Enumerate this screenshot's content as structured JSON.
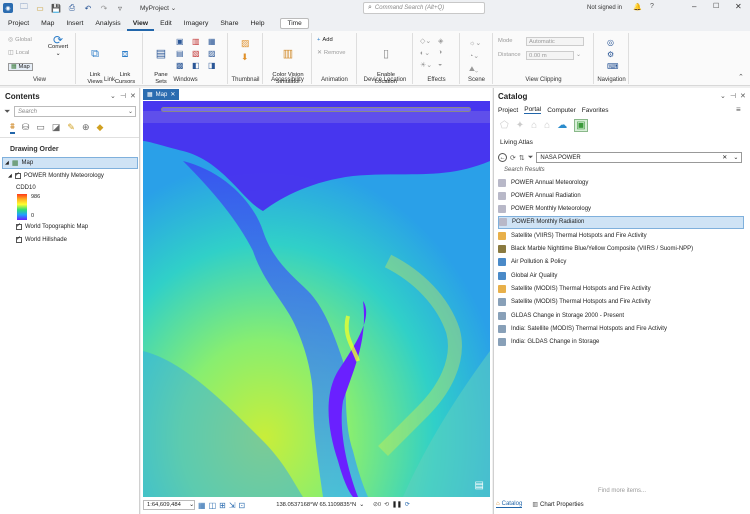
{
  "titlebar": {
    "project_name": "MyProject",
    "search_placeholder": "Command Search (Alt+Q)",
    "user_status": "Not signed in",
    "time_button": "Time"
  },
  "ribbon_tabs": [
    "Project",
    "Map",
    "Insert",
    "Analysis",
    "View",
    "Edit",
    "Imagery",
    "Share",
    "Help"
  ],
  "active_tab": "View",
  "ribbon": {
    "view": {
      "global": "Global",
      "local": "Local",
      "map": "Map",
      "convert": "Convert",
      "label": "View"
    },
    "link": {
      "link_views": "Link\nViews",
      "link_cursors": "Link\nCursors",
      "label": "Link"
    },
    "windows": {
      "pane_sets": "Pane\nSets",
      "label": "Windows"
    },
    "thumbnail": {
      "label": "Thumbnail"
    },
    "accessibility": {
      "color_vision": "Color Vision\nSimulator",
      "label": "Accessibility"
    },
    "animation": {
      "add": "Add",
      "remove": "Remove",
      "label": "Animation"
    },
    "device_location": {
      "enable": "Enable\nLocation",
      "label": "Device Location"
    },
    "effects": {
      "label": "Effects"
    },
    "scene": {
      "label": "Scene"
    },
    "view_clipping": {
      "mode_label": "Mode",
      "mode_value": "Automatic",
      "distance_label": "Distance",
      "distance_value": "0.00 m",
      "label": "View Clipping"
    },
    "navigation": {
      "label": "Navigation"
    }
  },
  "contents": {
    "title": "Contents",
    "search_placeholder": "Search",
    "drawing_order": "Drawing Order",
    "map_name": "Map",
    "layer_name": "POWER Monthly Meteorology",
    "legend_field": "CDD10",
    "legend_max": "986",
    "legend_min": "0",
    "basemap1": "World Topographic Map",
    "basemap2": "World Hillshade"
  },
  "map": {
    "tab_label": "Map",
    "scale": "1:64,609,484",
    "coordinates": "138.0537168°W 65.1109835°N",
    "selected_count": "0"
  },
  "catalog": {
    "title": "Catalog",
    "tabs": [
      "Project",
      "Portal",
      "Computer",
      "Favorites"
    ],
    "active_tab": "Portal",
    "section": "Living Atlas",
    "search_value": "NASA POWER",
    "results_label": "Search Results",
    "items": [
      {
        "label": "POWER Annual Meteorology",
        "icon": "raster-icon",
        "color": "#b8b8c8"
      },
      {
        "label": "POWER Annual Radiation",
        "icon": "raster-icon",
        "color": "#b8b8c8"
      },
      {
        "label": "POWER Monthly Meteorology",
        "icon": "raster-icon",
        "color": "#b8b8c8"
      },
      {
        "label": "POWER Monthly Radiation",
        "icon": "raster-icon",
        "color": "#b8b8c8"
      },
      {
        "label": "Satellite (VIIRS) Thermal Hotspots and Fire Activity",
        "icon": "feature-icon",
        "color": "#e8b04a"
      },
      {
        "label": "Black Marble Nighttime Blue/Yellow Composite (VIIRS / Suomi-NPP)",
        "icon": "imagery-icon",
        "color": "#8a7a40"
      },
      {
        "label": "Air Pollution & Policy",
        "icon": "web-app-icon",
        "color": "#4a8ac8"
      },
      {
        "label": "Global Air Quality",
        "icon": "web-app-icon",
        "color": "#4a8ac8"
      },
      {
        "label": "Satellite (MODIS) Thermal Hotspots and Fire Activity",
        "icon": "feature-icon",
        "color": "#e8b04a"
      },
      {
        "label": "Satellite (MODIS) Thermal Hotspots and Fire Activity",
        "icon": "map-icon",
        "color": "#88a0b8"
      },
      {
        "label": "GLDAS Change in Storage 2000 - Present",
        "icon": "map-icon",
        "color": "#88a0b8"
      },
      {
        "label": "India: Satellite (MODIS) Thermal Hotspots and Fire Activity",
        "icon": "map-icon",
        "color": "#88a0b8"
      },
      {
        "label": "India: GLDAS Change in Storage",
        "icon": "map-icon",
        "color": "#88a0b8"
      }
    ],
    "find_more": "Find more items...",
    "bottom_tabs": [
      "Catalog",
      "Chart Properties"
    ]
  },
  "colors": {
    "accent": "#2266aa",
    "selection": "#cfe3f5",
    "map_purple": "#5a2af0",
    "map_yellow": "#d9e83a"
  }
}
